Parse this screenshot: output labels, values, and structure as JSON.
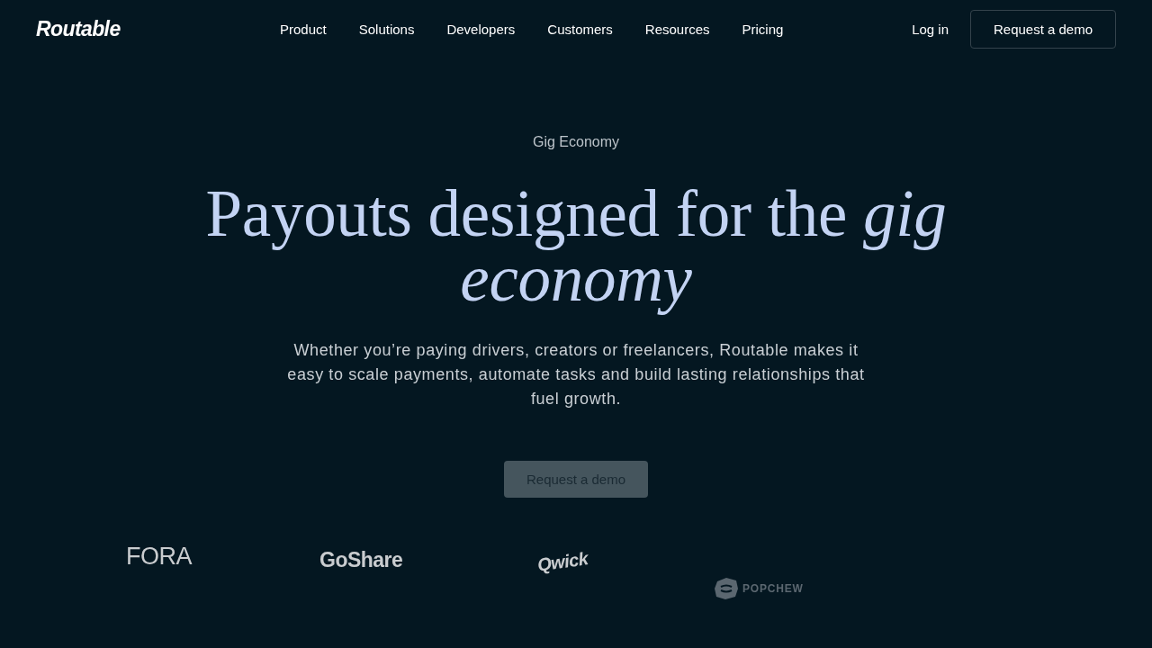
{
  "nav": {
    "logo": "Routable",
    "links": [
      "Product",
      "Solutions",
      "Developers",
      "Customers",
      "Resources",
      "Pricing"
    ],
    "login": "Log in",
    "cta": "Request a demo"
  },
  "hero": {
    "eyebrow": "Gig Economy",
    "heading": "Payouts designed for the *gig economy*",
    "body": "Whether you’re paying drivers, creators or freelancers, Routable makes it easy to scale payments, automate tasks and build lasting relationships that fuel growth.",
    "cta": "Request a demo"
  },
  "logos": [
    {
      "kind": "fora",
      "name": "FORA"
    },
    {
      "kind": "goshare",
      "name": "GoShare"
    },
    {
      "kind": "qwick",
      "name": "Qwick"
    },
    {
      "kind": "popchew",
      "name": "POPCHEW"
    }
  ]
}
